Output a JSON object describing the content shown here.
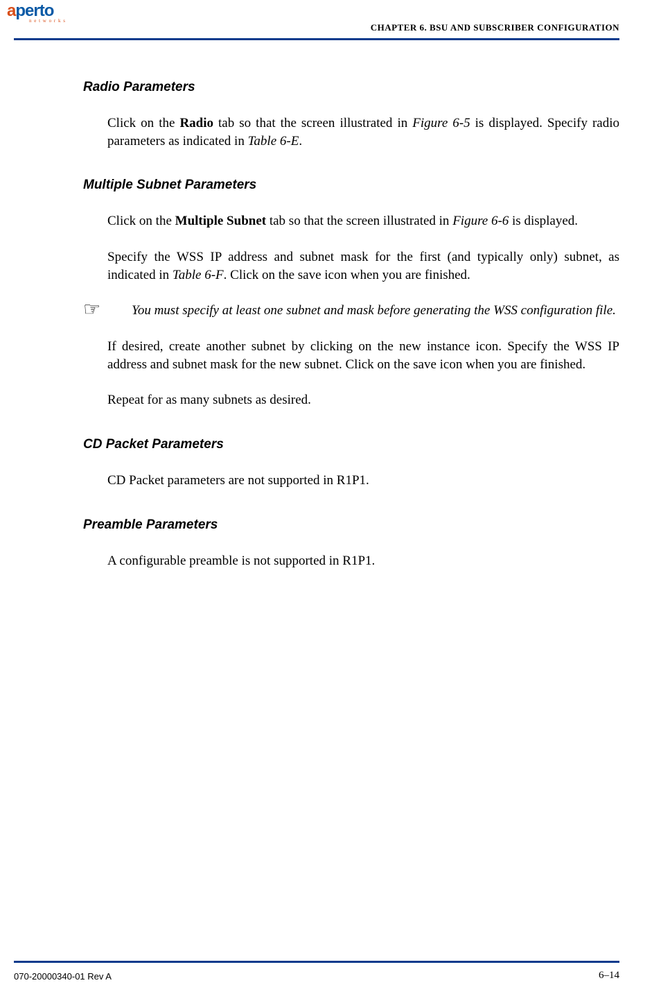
{
  "logo": {
    "part1": "a",
    "part2": "perto",
    "sub": "n e t w o r k s"
  },
  "header": {
    "chapter": "CHAPTER 6.  BSU AND SUBSCRIBER CONFIGURATION"
  },
  "sections": {
    "radio": {
      "heading": "Radio Parameters",
      "p1_pre": "Click on the ",
      "p1_bold": "Radio",
      "p1_mid": " tab so that the screen illustrated in ",
      "p1_fig": "Figure 6-5",
      "p1_post": " is displayed. Specify radio parameters as indicated in ",
      "p1_tbl": "Table 6-E",
      "p1_end": "."
    },
    "multi": {
      "heading": "Multiple Subnet Parameters",
      "p1_pre": "Click on the ",
      "p1_bold": "Multiple Subnet",
      "p1_mid": " tab so that the screen illustrated in ",
      "p1_fig": "Figure 6-6",
      "p1_post": " is displayed.",
      "p2_pre": "Specify the WSS IP address and subnet mask for the first (and typically only) subnet, as indicated in ",
      "p2_tbl": "Table 6-F",
      "p2_post": ". Click on the save icon when you are finished.",
      "note": "You must specify at least one subnet and mask before generating the WSS configuration file.",
      "p3": "If desired, create another subnet by clicking on the new instance icon. Specify the WSS IP address and subnet mask for the new subnet. Click on the save icon when you are finished.",
      "p4": "Repeat for as many subnets as desired."
    },
    "cd": {
      "heading": "CD Packet Parameters",
      "p1": "CD Packet parameters are not supported in R1P1."
    },
    "preamble": {
      "heading": "Preamble Parameters",
      "p1": "A configurable preamble is not supported in R1P1."
    }
  },
  "footer": {
    "left": "070-20000340-01 Rev A",
    "right": "6–14"
  }
}
